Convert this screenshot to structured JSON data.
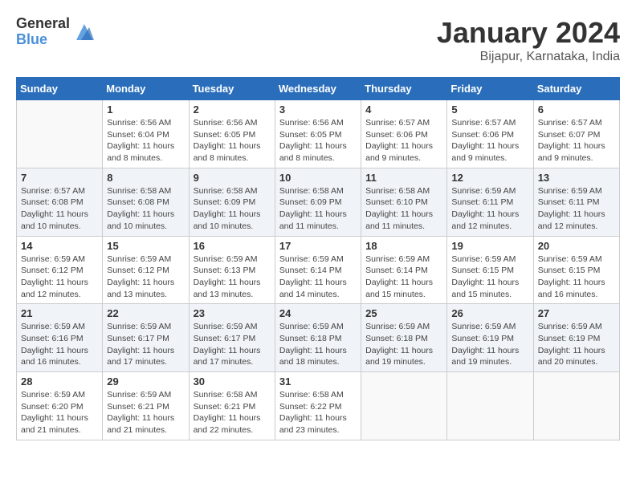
{
  "header": {
    "logo_general": "General",
    "logo_blue": "Blue",
    "title": "January 2024",
    "location": "Bijapur, Karnataka, India"
  },
  "calendar": {
    "days_of_week": [
      "Sunday",
      "Monday",
      "Tuesday",
      "Wednesday",
      "Thursday",
      "Friday",
      "Saturday"
    ],
    "weeks": [
      [
        {
          "day": "",
          "info": ""
        },
        {
          "day": "1",
          "info": "Sunrise: 6:56 AM\nSunset: 6:04 PM\nDaylight: 11 hours\nand 8 minutes."
        },
        {
          "day": "2",
          "info": "Sunrise: 6:56 AM\nSunset: 6:05 PM\nDaylight: 11 hours\nand 8 minutes."
        },
        {
          "day": "3",
          "info": "Sunrise: 6:56 AM\nSunset: 6:05 PM\nDaylight: 11 hours\nand 8 minutes."
        },
        {
          "day": "4",
          "info": "Sunrise: 6:57 AM\nSunset: 6:06 PM\nDaylight: 11 hours\nand 9 minutes."
        },
        {
          "day": "5",
          "info": "Sunrise: 6:57 AM\nSunset: 6:06 PM\nDaylight: 11 hours\nand 9 minutes."
        },
        {
          "day": "6",
          "info": "Sunrise: 6:57 AM\nSunset: 6:07 PM\nDaylight: 11 hours\nand 9 minutes."
        }
      ],
      [
        {
          "day": "7",
          "info": "Sunrise: 6:57 AM\nSunset: 6:08 PM\nDaylight: 11 hours\nand 10 minutes."
        },
        {
          "day": "8",
          "info": "Sunrise: 6:58 AM\nSunset: 6:08 PM\nDaylight: 11 hours\nand 10 minutes."
        },
        {
          "day": "9",
          "info": "Sunrise: 6:58 AM\nSunset: 6:09 PM\nDaylight: 11 hours\nand 10 minutes."
        },
        {
          "day": "10",
          "info": "Sunrise: 6:58 AM\nSunset: 6:09 PM\nDaylight: 11 hours\nand 11 minutes."
        },
        {
          "day": "11",
          "info": "Sunrise: 6:58 AM\nSunset: 6:10 PM\nDaylight: 11 hours\nand 11 minutes."
        },
        {
          "day": "12",
          "info": "Sunrise: 6:59 AM\nSunset: 6:11 PM\nDaylight: 11 hours\nand 12 minutes."
        },
        {
          "day": "13",
          "info": "Sunrise: 6:59 AM\nSunset: 6:11 PM\nDaylight: 11 hours\nand 12 minutes."
        }
      ],
      [
        {
          "day": "14",
          "info": "Sunrise: 6:59 AM\nSunset: 6:12 PM\nDaylight: 11 hours\nand 12 minutes."
        },
        {
          "day": "15",
          "info": "Sunrise: 6:59 AM\nSunset: 6:12 PM\nDaylight: 11 hours\nand 13 minutes."
        },
        {
          "day": "16",
          "info": "Sunrise: 6:59 AM\nSunset: 6:13 PM\nDaylight: 11 hours\nand 13 minutes."
        },
        {
          "day": "17",
          "info": "Sunrise: 6:59 AM\nSunset: 6:14 PM\nDaylight: 11 hours\nand 14 minutes."
        },
        {
          "day": "18",
          "info": "Sunrise: 6:59 AM\nSunset: 6:14 PM\nDaylight: 11 hours\nand 15 minutes."
        },
        {
          "day": "19",
          "info": "Sunrise: 6:59 AM\nSunset: 6:15 PM\nDaylight: 11 hours\nand 15 minutes."
        },
        {
          "day": "20",
          "info": "Sunrise: 6:59 AM\nSunset: 6:15 PM\nDaylight: 11 hours\nand 16 minutes."
        }
      ],
      [
        {
          "day": "21",
          "info": "Sunrise: 6:59 AM\nSunset: 6:16 PM\nDaylight: 11 hours\nand 16 minutes."
        },
        {
          "day": "22",
          "info": "Sunrise: 6:59 AM\nSunset: 6:17 PM\nDaylight: 11 hours\nand 17 minutes."
        },
        {
          "day": "23",
          "info": "Sunrise: 6:59 AM\nSunset: 6:17 PM\nDaylight: 11 hours\nand 17 minutes."
        },
        {
          "day": "24",
          "info": "Sunrise: 6:59 AM\nSunset: 6:18 PM\nDaylight: 11 hours\nand 18 minutes."
        },
        {
          "day": "25",
          "info": "Sunrise: 6:59 AM\nSunset: 6:18 PM\nDaylight: 11 hours\nand 19 minutes."
        },
        {
          "day": "26",
          "info": "Sunrise: 6:59 AM\nSunset: 6:19 PM\nDaylight: 11 hours\nand 19 minutes."
        },
        {
          "day": "27",
          "info": "Sunrise: 6:59 AM\nSunset: 6:19 PM\nDaylight: 11 hours\nand 20 minutes."
        }
      ],
      [
        {
          "day": "28",
          "info": "Sunrise: 6:59 AM\nSunset: 6:20 PM\nDaylight: 11 hours\nand 21 minutes."
        },
        {
          "day": "29",
          "info": "Sunrise: 6:59 AM\nSunset: 6:21 PM\nDaylight: 11 hours\nand 21 minutes."
        },
        {
          "day": "30",
          "info": "Sunrise: 6:58 AM\nSunset: 6:21 PM\nDaylight: 11 hours\nand 22 minutes."
        },
        {
          "day": "31",
          "info": "Sunrise: 6:58 AM\nSunset: 6:22 PM\nDaylight: 11 hours\nand 23 minutes."
        },
        {
          "day": "",
          "info": ""
        },
        {
          "day": "",
          "info": ""
        },
        {
          "day": "",
          "info": ""
        }
      ]
    ]
  }
}
